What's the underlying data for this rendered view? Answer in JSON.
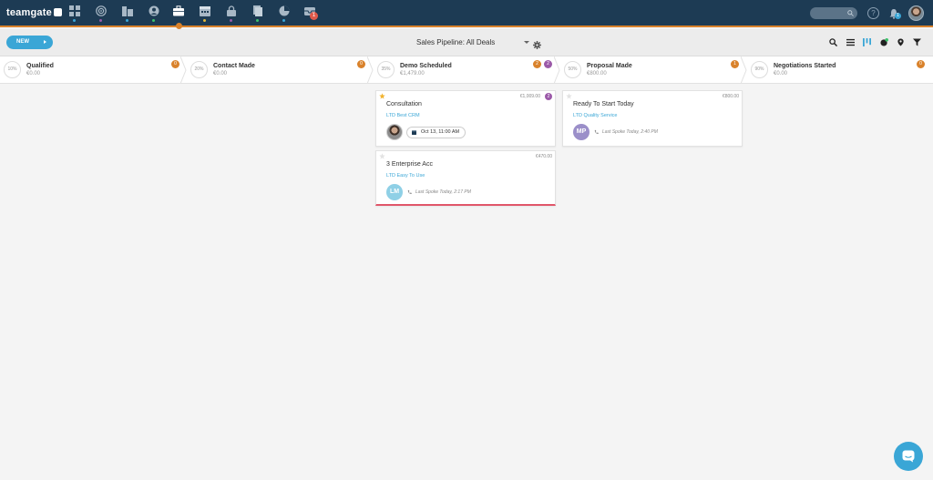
{
  "app": {
    "logo_text": "teamgate",
    "nav_icons": [
      {
        "name": "dashboard-icon",
        "dot_color": "#3aa6d6"
      },
      {
        "name": "target-icon",
        "dot_color": "#9b59a8"
      },
      {
        "name": "companies-icon",
        "dot_color": "#3aa6d6"
      },
      {
        "name": "people-icon",
        "dot_color": "#3cc36b"
      },
      {
        "name": "deals-icon",
        "dot_color": "#d9822b",
        "active": true
      },
      {
        "name": "calendar-icon",
        "dot_color": "#e0b83a"
      },
      {
        "name": "lock-icon",
        "dot_color": "#9b59a8"
      },
      {
        "name": "documents-icon",
        "dot_color": "#3cc36b"
      },
      {
        "name": "reports-icon",
        "dot_color": "#3aa6d6"
      },
      {
        "name": "inbox-icon",
        "dot_color": "#e05a4b"
      }
    ],
    "notification_count": "1",
    "bell_count": "1",
    "help_label": "?"
  },
  "toolbar": {
    "new_label": "NEW",
    "pipeline_title": "Sales Pipeline: All Deals",
    "icons": [
      "search-icon",
      "list-view-icon",
      "board-view-icon",
      "forecast-icon",
      "map-pin-icon",
      "filter-icon"
    ]
  },
  "stages": [
    {
      "pct": "10%",
      "name": "Qualified",
      "amount": "€0.00",
      "badges": [
        {
          "count": "0",
          "color": "orange"
        }
      ]
    },
    {
      "pct": "20%",
      "name": "Contact Made",
      "amount": "€0.00",
      "badges": [
        {
          "count": "0",
          "color": "orange"
        }
      ]
    },
    {
      "pct": "35%",
      "name": "Demo Scheduled",
      "amount": "€1,479.00",
      "badges": [
        {
          "count": "2",
          "color": "orange"
        },
        {
          "count": "2",
          "color": "purple"
        }
      ]
    },
    {
      "pct": "50%",
      "name": "Proposal Made",
      "amount": "€800.00",
      "badges": [
        {
          "count": "1",
          "color": "orange"
        }
      ]
    },
    {
      "pct": "90%",
      "name": "Negotiations Started",
      "amount": "€0.00",
      "badges": [
        {
          "count": "0",
          "color": "orange"
        }
      ]
    }
  ],
  "cards": [
    {
      "stage": "Demo Scheduled",
      "starred": true,
      "amount": "€1,009.00",
      "badge": "2",
      "title": "Consultation",
      "company": "LTD Best CRM",
      "avatar": "photo",
      "chip": "Oct 13, 11:00 AM"
    },
    {
      "stage": "Demo Scheduled",
      "starred": false,
      "amount": "€470.00",
      "title": "3 Enterprise Acc",
      "company": "LTD Easy To Use",
      "avatar_initials": "LM",
      "avatar_color": "#8fd0e6",
      "last_spoke": "Last Spoke Today, 2:17 PM"
    },
    {
      "stage": "Proposal Made",
      "starred": false,
      "amount": "€800.00",
      "title": "Ready To Start Today",
      "company": "LTD Quality Service",
      "avatar_initials": "MP",
      "avatar_color": "#9b8fc9",
      "last_spoke": "Last Spoke Today, 2:40 PM"
    }
  ]
}
